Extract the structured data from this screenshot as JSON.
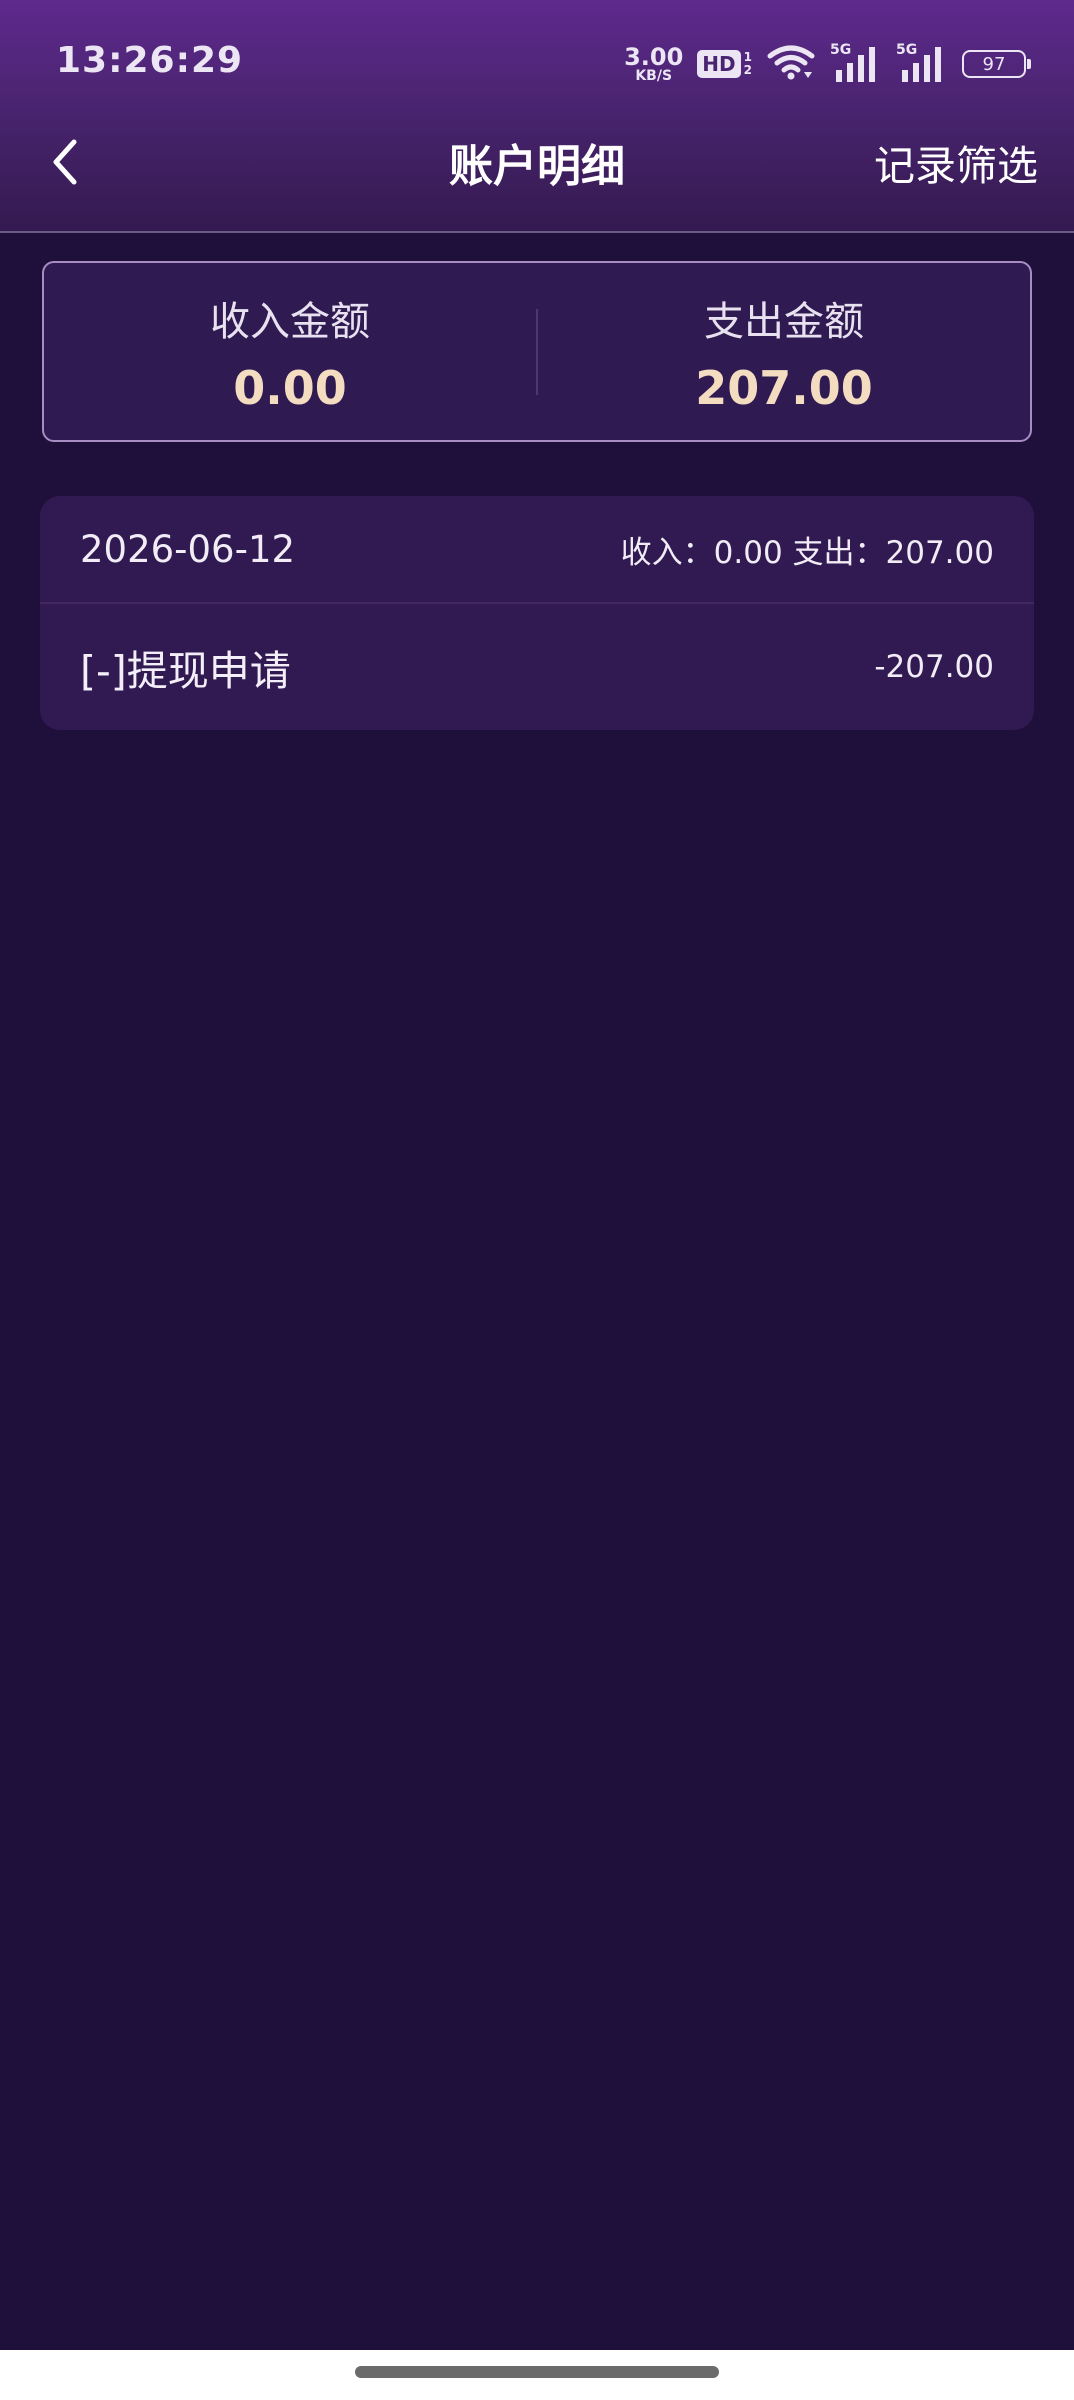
{
  "status_bar": {
    "time": "13:26:29",
    "net_speed_value": "3.00",
    "net_speed_unit": "KB/S",
    "hd_label": "HD",
    "hd_sub_top": "1",
    "hd_sub_bottom": "2",
    "sim1_tag": "5G",
    "sim2_tag": "5G",
    "battery_level": "97"
  },
  "header": {
    "title": "账户明细",
    "back_icon": "chevron-left-icon",
    "filter_label": "记录筛选"
  },
  "summary": {
    "income_label": "收入金额",
    "income_value": "0.00",
    "expense_label": "支出金额",
    "expense_value": "207.00"
  },
  "records": [
    {
      "date": "2026-06-12",
      "day_summary": "收入：0.00 支出：207.00",
      "items": [
        {
          "title": "[-]提现申请",
          "amount": "-207.00"
        }
      ]
    }
  ],
  "colors": {
    "background": "#1f0f3b",
    "header_gradient_top": "#5e2a8d",
    "card_background": "#311a52",
    "amount_highlight": "#f4dcc0",
    "summary_border": "#a88dc3"
  }
}
